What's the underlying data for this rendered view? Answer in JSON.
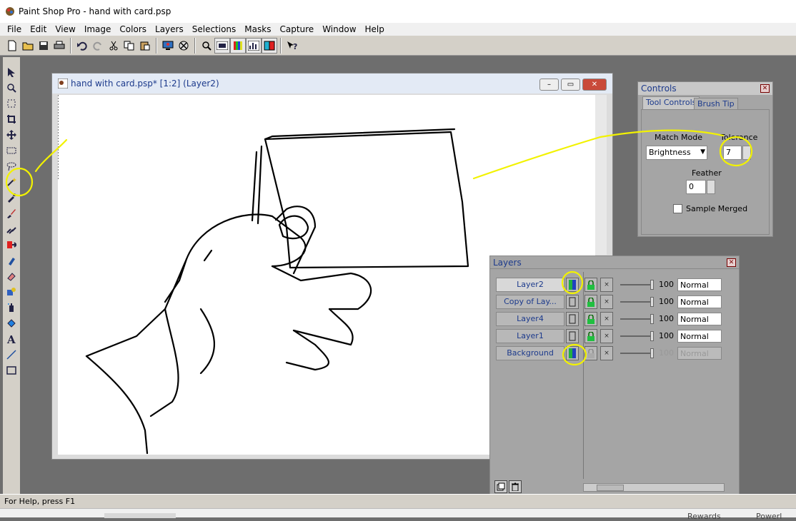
{
  "app": {
    "title": "Paint Shop Pro - hand with card.psp"
  },
  "menu": [
    "File",
    "Edit",
    "View",
    "Image",
    "Colors",
    "Layers",
    "Selections",
    "Masks",
    "Capture",
    "Window",
    "Help"
  ],
  "toolbar_icons": [
    "new-icon",
    "open-icon",
    "save-icon",
    "print-icon",
    "undo-icon",
    "redo-icon",
    "cut-icon",
    "copy-icon",
    "paste-icon",
    "screen-icon",
    "cancel-icon",
    "zoom-icon",
    "histogram-icon",
    "color-palette-icon",
    "chart-icon",
    "layers-icon",
    "help-icon"
  ],
  "tools": [
    "arrow-icon",
    "zoom-icon",
    "deformation-icon",
    "crop-icon",
    "mover-icon",
    "selection-icon",
    "freehand-icon",
    "magic-wand-icon",
    "dropper-icon",
    "paintbrush-icon",
    "clone-icon",
    "color-replacer-icon",
    "retouch-icon",
    "eraser-icon",
    "picture-tube-icon",
    "airbrush-icon",
    "flood-fill-icon",
    "text-icon",
    "draw-icon",
    "preset-shapes-icon"
  ],
  "document": {
    "title": "hand with card.psp* [1:2] (Layer2)"
  },
  "controls": {
    "title": "Controls",
    "tab_tool_controls": "Tool Controls",
    "tab_brush_tip": "Brush Tip",
    "match_mode_label": "Match Mode",
    "match_mode_value": "Brightness",
    "tolerance_label": "Tolerance",
    "tolerance_value": "7",
    "feather_label": "Feather",
    "feather_value": "0",
    "sample_merged_label": "Sample Merged"
  },
  "layers": {
    "title": "Layers",
    "rows": [
      {
        "name": "Layer2",
        "opacity": "100",
        "blend": "Normal"
      },
      {
        "name": "Copy of Lay...",
        "opacity": "100",
        "blend": "Normal"
      },
      {
        "name": "Layer4",
        "opacity": "100",
        "blend": "Normal"
      },
      {
        "name": "Layer1",
        "opacity": "100",
        "blend": "Normal"
      },
      {
        "name": "Background",
        "opacity": "100",
        "blend": "Normal"
      }
    ]
  },
  "status": {
    "text": "For Help, press F1"
  },
  "taskbar": {
    "item1": "Rewards",
    "item2": "Powerl"
  }
}
